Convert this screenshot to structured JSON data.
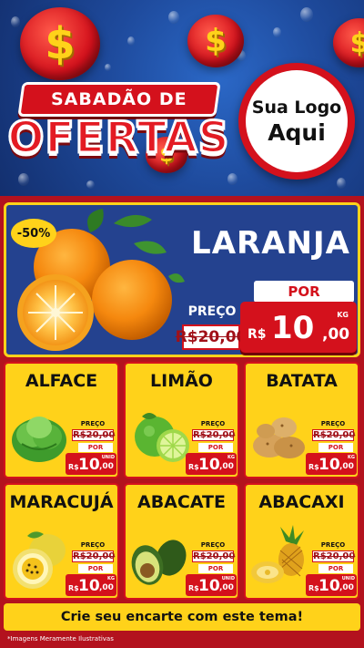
{
  "header": {
    "title_top": "SABADÃO DE",
    "title_main": "OFERTAS",
    "logo_line1": "Sua Logo",
    "logo_line2": "Aqui",
    "coin_symbol": "$"
  },
  "featured": {
    "discount": "-50%",
    "name": "LARANJA",
    "preco_label": "PREÇO",
    "old_price": "R$20,00",
    "por_label": "POR",
    "currency": "R$",
    "price_int": "10",
    "price_dec": ",00",
    "unit": "KG"
  },
  "products": [
    {
      "name": "ALFACE",
      "preco_label": "PREÇO",
      "old_price": "R$20,00",
      "por_label": "POR",
      "currency": "R$",
      "price_int": "10",
      "price_dec": ",00",
      "unit": "UNID"
    },
    {
      "name": "LIMÃO",
      "preco_label": "PREÇO",
      "old_price": "R$20,00",
      "por_label": "POR",
      "currency": "R$",
      "price_int": "10",
      "price_dec": ",00",
      "unit": "KG"
    },
    {
      "name": "BATATA",
      "preco_label": "PREÇO",
      "old_price": "R$20,00",
      "por_label": "POR",
      "currency": "R$",
      "price_int": "10",
      "price_dec": ",00",
      "unit": "KG"
    },
    {
      "name": "MARACUJÁ",
      "preco_label": "PREÇO",
      "old_price": "R$20,00",
      "por_label": "POR",
      "currency": "R$",
      "price_int": "10",
      "price_dec": ",00",
      "unit": "KG"
    },
    {
      "name": "ABACATE",
      "preco_label": "PREÇO",
      "old_price": "R$20,00",
      "por_label": "POR",
      "currency": "R$",
      "price_int": "10",
      "price_dec": ",00",
      "unit": "UNID"
    },
    {
      "name": "ABACAXI",
      "preco_label": "PREÇO",
      "old_price": "R$20,00",
      "por_label": "POR",
      "currency": "R$",
      "price_int": "10",
      "price_dec": ",00",
      "unit": "UNID"
    }
  ],
  "cta": "Crie seu encarte com este tema!",
  "footnote": "*Imagens Meramente Ilustrativas",
  "colors": {
    "red": "#d4111c",
    "yellow": "#ffd21a",
    "blue": "#24428f"
  }
}
